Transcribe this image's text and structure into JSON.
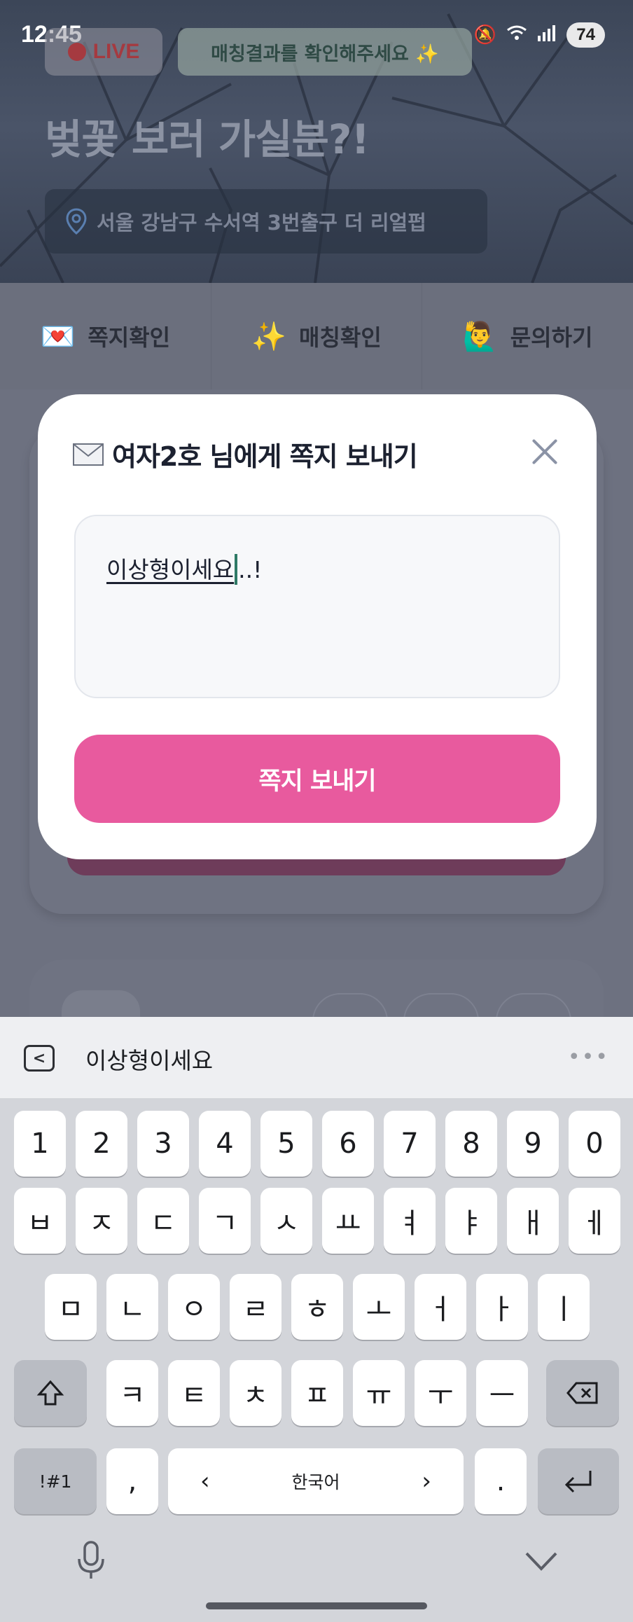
{
  "status_bar": {
    "time": "12:45",
    "battery": "74"
  },
  "header": {
    "live_label": "LIVE",
    "match_notice": "매칭결과를 확인해주세요 ✨",
    "title": "벚꽃 보러 가실분?!",
    "location": "서울 강남구 수서역 3번출구 더 리얼펍"
  },
  "tabs": [
    {
      "emoji": "💌",
      "label": "쪽지확인"
    },
    {
      "emoji": "✨",
      "label": "매칭확인"
    },
    {
      "emoji": "🙋‍♂️",
      "label": "문의하기"
    }
  ],
  "modal": {
    "title": "여자2호 님에게 쪽지 보내기",
    "message_composing": "이상형이세요",
    "message_rest": "..!",
    "send_label": "쪽지 보내기"
  },
  "keyboard": {
    "suggestion": "이상형이세요",
    "row_numbers": [
      "1",
      "2",
      "3",
      "4",
      "5",
      "6",
      "7",
      "8",
      "9",
      "0"
    ],
    "row_1": [
      "ㅂ",
      "ㅈ",
      "ㄷ",
      "ㄱ",
      "ㅅ",
      "ㅛ",
      "ㅕ",
      "ㅑ",
      "ㅐ",
      "ㅔ"
    ],
    "row_2": [
      "ㅁ",
      "ㄴ",
      "ㅇ",
      "ㄹ",
      "ㅎ",
      "ㅗ",
      "ㅓ",
      "ㅏ",
      "ㅣ"
    ],
    "row_3": [
      "ㅋ",
      "ㅌ",
      "ㅊ",
      "ㅍ",
      "ㅠ",
      "ㅜ",
      "ㅡ"
    ],
    "symbols_label": "!#1",
    "comma_label": ",",
    "space_label": "한국어",
    "period_label": ".",
    "left_arrow": "‹",
    "right_arrow": "›"
  },
  "colors": {
    "accent_pink": "#e85a9e",
    "overlay": "#6d7180"
  }
}
